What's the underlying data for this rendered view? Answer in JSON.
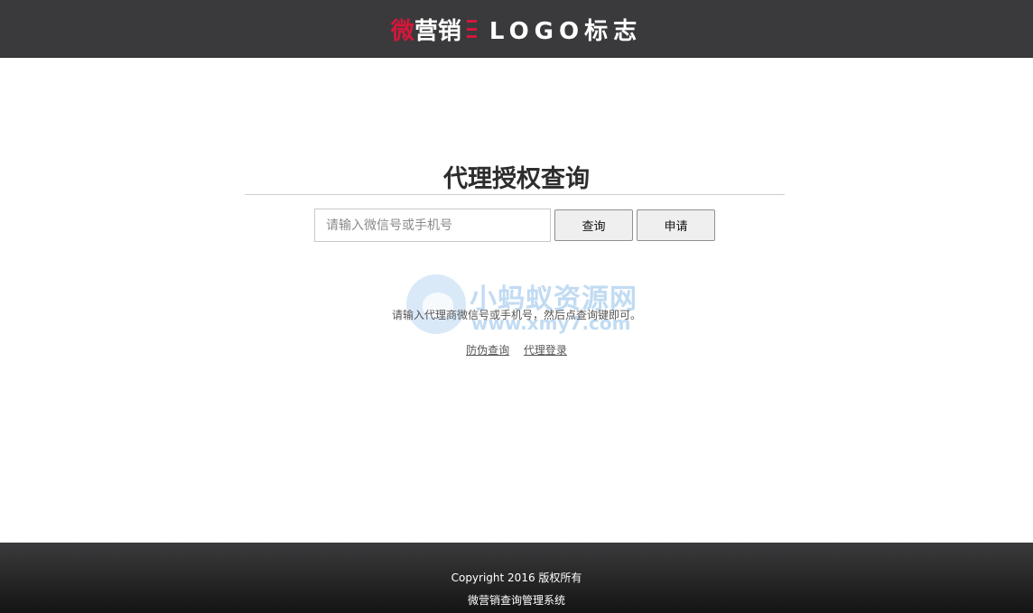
{
  "header": {
    "logo_wei": "微",
    "logo_brand": "营销",
    "logo_text": "LOGO标志",
    "colors": {
      "background": "#3a3a3c",
      "accent": "#d6163a"
    }
  },
  "main": {
    "title": "代理授权查询",
    "search": {
      "placeholder": "请输入微信号或手机号",
      "value": ""
    },
    "query_button": "查询",
    "apply_button": "申请",
    "hint": "请输入代理商微信号或手机号，然后点查询键即可。",
    "links": [
      "防伪查询",
      "代理登录"
    ]
  },
  "watermark": {
    "name": "小蚂蚁资源网",
    "url": "www.xmy7.com"
  },
  "footer": {
    "copyright": "Copyright 2016 版权所有",
    "system_name": "微营销查询管理系统"
  }
}
